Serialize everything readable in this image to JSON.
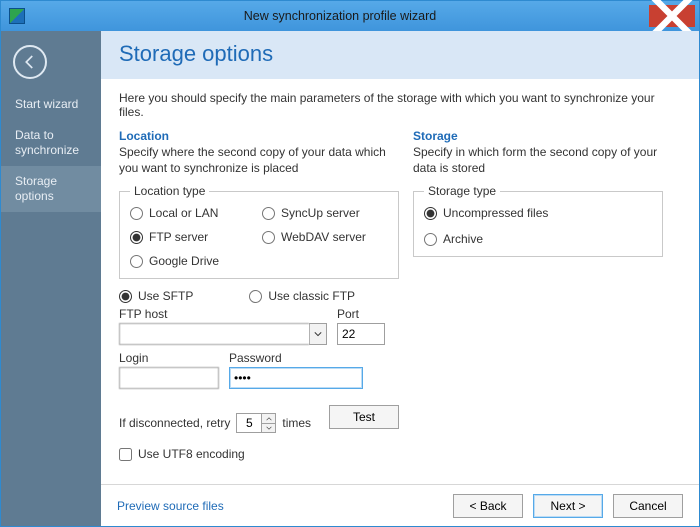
{
  "window": {
    "title": "New synchronization profile wizard"
  },
  "sidebar": {
    "items": [
      {
        "label": "Start wizard"
      },
      {
        "label": "Data to synchronize"
      },
      {
        "label": "Storage options"
      }
    ]
  },
  "header": {
    "title": "Storage options"
  },
  "intro": "Here you should specify the main parameters of the storage with which you want to synchronize your files.",
  "location": {
    "title": "Location",
    "desc": "Specify where the second copy of your data which you want to synchronize is placed",
    "group_label": "Location type",
    "options": {
      "local": "Local or LAN",
      "syncup": "SyncUp server",
      "ftp": "FTP server",
      "webdav": "WebDAV server",
      "gdrive": "Google Drive"
    },
    "selected": "ftp",
    "ftp_mode": {
      "sftp": "Use SFTP",
      "classic": "Use classic FTP",
      "selected": "sftp"
    },
    "ftp_host": {
      "label": "FTP host",
      "value": ""
    },
    "port": {
      "label": "Port",
      "value": "22"
    },
    "login": {
      "label": "Login",
      "value": ""
    },
    "password": {
      "label": "Password",
      "value": "••••"
    },
    "retry": {
      "prefix": "If disconnected, retry",
      "value": "5",
      "suffix": "times"
    },
    "test": "Test",
    "utf8": {
      "label": "Use UTF8 encoding",
      "checked": false
    }
  },
  "storage": {
    "title": "Storage",
    "desc": "Specify in which form the second copy of your data is stored",
    "group_label": "Storage type",
    "options": {
      "uncompressed": "Uncompressed files",
      "archive": "Archive"
    },
    "selected": "uncompressed"
  },
  "footer": {
    "preview": "Preview source files",
    "back": "< Back",
    "next": "Next >",
    "cancel": "Cancel"
  }
}
